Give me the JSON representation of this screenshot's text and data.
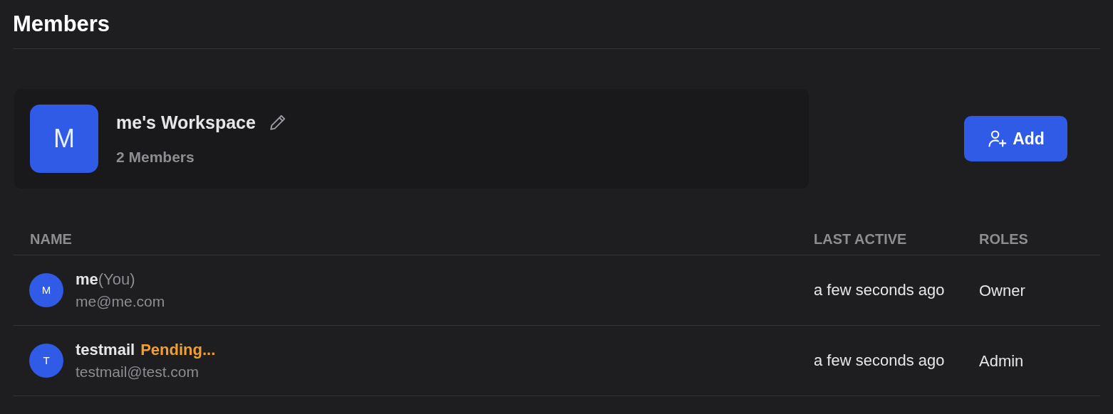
{
  "title": "Members",
  "workspace": {
    "avatar_letter": "M",
    "name": "me's Workspace",
    "member_count": "2 Members"
  },
  "add_button": {
    "label": "Add"
  },
  "table": {
    "columns": [
      "NAME",
      "LAST ACTIVE",
      "ROLES"
    ],
    "rows": [
      {
        "avatar_letter": "M",
        "name": "me",
        "tag": "(You)",
        "kind": "you",
        "email": "me@me.com",
        "last_active": "a few seconds ago",
        "role": "Owner"
      },
      {
        "avatar_letter": "T",
        "name": "testmail",
        "tag": "Pending...",
        "kind": "pending",
        "email": "testmail@test.com",
        "last_active": "a few seconds ago",
        "role": "Admin"
      }
    ]
  }
}
